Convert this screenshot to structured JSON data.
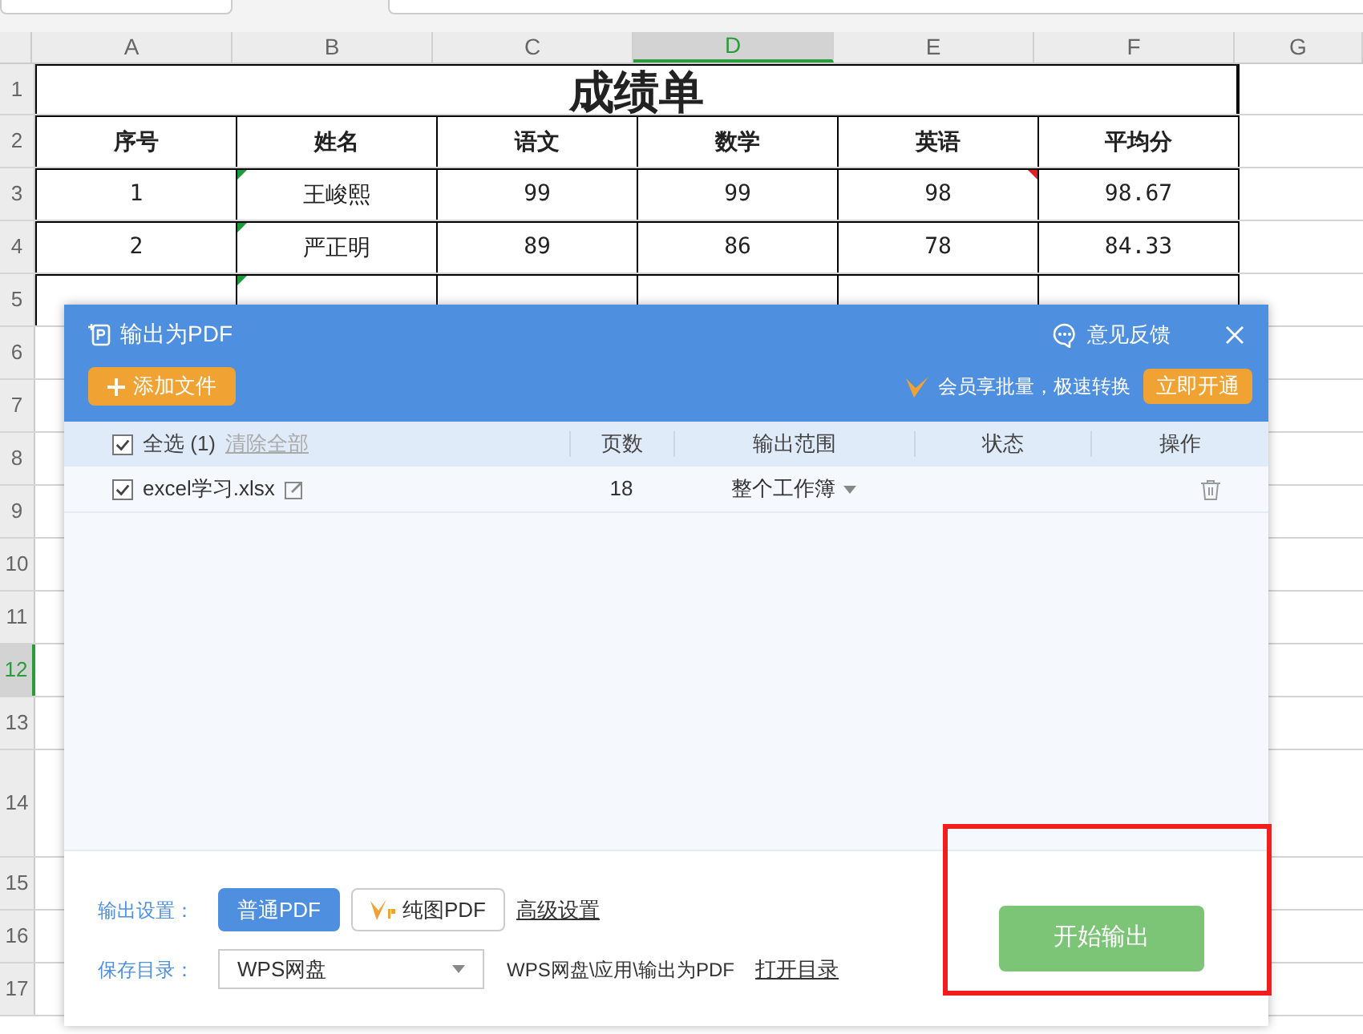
{
  "columns": [
    {
      "label": "A",
      "selected": false
    },
    {
      "label": "B",
      "selected": false
    },
    {
      "label": "C",
      "selected": false
    },
    {
      "label": "D",
      "selected": true
    },
    {
      "label": "E",
      "selected": false
    },
    {
      "label": "F",
      "selected": false
    },
    {
      "label": "G",
      "selected": false
    }
  ],
  "rows": [
    {
      "label": "1",
      "selected": false,
      "title": "成绩单"
    },
    {
      "label": "2",
      "selected": false,
      "cells": [
        {
          "text": "序号"
        },
        {
          "text": "姓名"
        },
        {
          "text": "语文"
        },
        {
          "text": "数学"
        },
        {
          "text": "英语"
        },
        {
          "text": "平均分"
        }
      ],
      "header": true
    },
    {
      "label": "3",
      "selected": false,
      "cells": [
        {
          "text": "1"
        },
        {
          "text": "王峻熙",
          "color": "#1a9c3c",
          "comment": false
        },
        {
          "text": "99"
        },
        {
          "text": "99"
        },
        {
          "text": "98",
          "color": "#e02020",
          "comment": true
        },
        {
          "text": "98.67"
        }
      ]
    },
    {
      "label": "4",
      "selected": false,
      "cells": [
        {
          "text": "2"
        },
        {
          "text": "严正明",
          "color": "#1a9c3c",
          "comment": false
        },
        {
          "text": "89"
        },
        {
          "text": "86"
        },
        {
          "text": "78"
        },
        {
          "text": "84.33"
        }
      ]
    },
    {
      "label": "5",
      "selected": false,
      "cells": [
        {},
        {
          "color": "#1a9c3c",
          "comment": false
        },
        {},
        {},
        {},
        {}
      ]
    },
    {
      "label": "6",
      "selected": false
    },
    {
      "label": "7",
      "selected": false
    },
    {
      "label": "8",
      "selected": false
    },
    {
      "label": "9",
      "selected": false
    },
    {
      "label": "10",
      "selected": false
    },
    {
      "label": "11",
      "selected": false
    },
    {
      "label": "12",
      "selected": true
    },
    {
      "label": "13",
      "selected": false
    },
    {
      "label": "14",
      "selected": false,
      "tall": true
    },
    {
      "label": "15",
      "selected": false
    },
    {
      "label": "16",
      "selected": false
    },
    {
      "label": "17",
      "selected": false
    }
  ],
  "dialog": {
    "title": "输出为PDF",
    "feedback": "意见反馈",
    "add_button": "添加文件",
    "promo": "会员享批量，极速转换",
    "promo_button": "立即开通",
    "list_header": {
      "select_all": "全选 (1)",
      "checked": true,
      "clear": "清除全部",
      "columns": [
        "页数",
        "输出范围",
        "状态",
        "操作"
      ]
    },
    "files": [
      {
        "name": "excel学习.xlsx",
        "checked": true,
        "pages": "18",
        "range": "整个工作簿"
      }
    ],
    "output_label": "输出设置：",
    "output_types": [
      {
        "label": "普通PDF",
        "selected": true,
        "vip": false
      },
      {
        "label": "纯图PDF",
        "selected": false,
        "vip": true
      }
    ],
    "advanced": "高级设置",
    "save_label": "保存目录：",
    "save_select": "WPS网盘",
    "save_path": "WPS网盘\\应用\\输出为PDF",
    "open_dir": "打开目录",
    "start_button": "开始输出"
  }
}
